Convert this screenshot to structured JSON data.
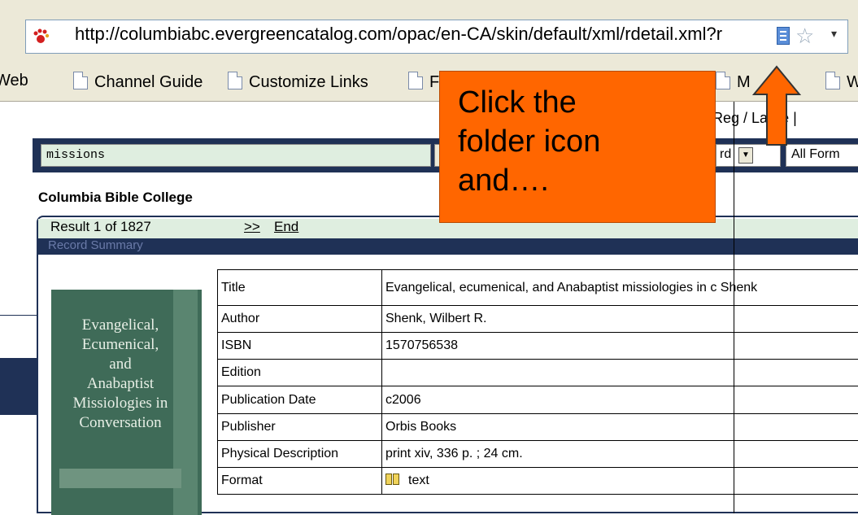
{
  "browser": {
    "url": "http://columbiabc.evergreencatalog.com/opac/en-CA/skin/default/xml/rdetail.xml?r",
    "links": [
      "Web",
      "Channel Guide",
      "Customize Links",
      "F",
      "M",
      "W"
    ]
  },
  "page": {
    "search_value": "missions",
    "search_type_value": "rd",
    "format_value": "All Form",
    "size_label": ": Reg",
    "size_large": "Large |",
    "library_name": "Columbia Bible College",
    "result_count": "Result 1 of 1827",
    "next_label": ">>",
    "end_label": "End",
    "summary_label": "Record Summary",
    "cover_title": "Evangelical,\nEcumenical,\nand\nAnabaptist\nMissiologies in\nConversation",
    "record": [
      {
        "label": "Title",
        "value": "Evangelical, ecumenical, and Anabaptist missiologies in c Shenk"
      },
      {
        "label": "Author",
        "value": "Shenk, Wilbert R."
      },
      {
        "label": "ISBN",
        "value": "1570756538"
      },
      {
        "label": "Edition",
        "value": ""
      },
      {
        "label": "Publication Date",
        "value": "c2006"
      },
      {
        "label": "Publisher",
        "value": "Orbis Books"
      },
      {
        "label": "Physical Description",
        "value": "print xiv, 336 p. ; 24 cm."
      },
      {
        "label": "Format",
        "value": "text"
      }
    ]
  },
  "callout": {
    "text": "Click the\nfolder icon\nand…."
  },
  "icons": {
    "site": "paw-icon",
    "bookmark": "bookmark-icon",
    "star": "star-icon",
    "arrow": "arrow-up-icon"
  },
  "colors": {
    "navy": "#1f3156",
    "callout": "#ff6600",
    "result_bar": "#dfeee0"
  }
}
